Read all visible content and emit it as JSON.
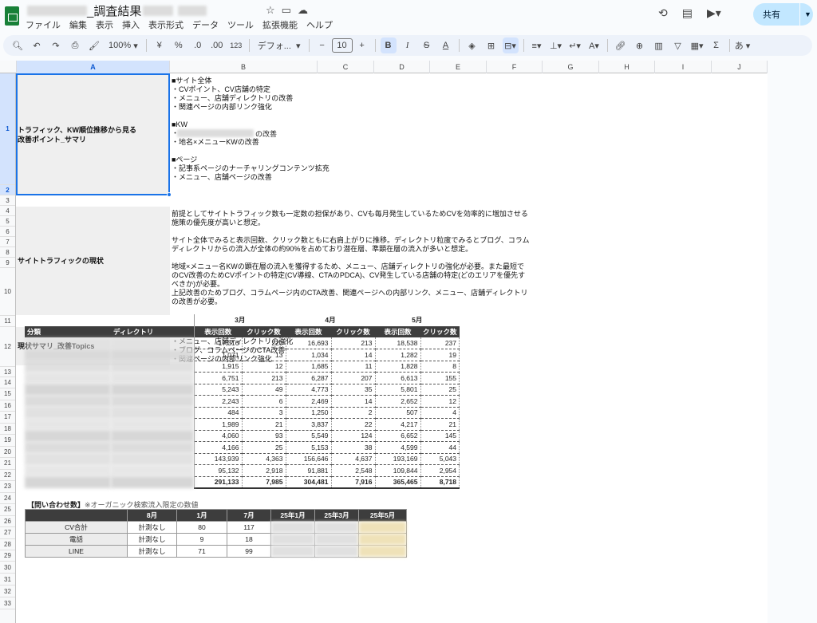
{
  "header": {
    "title": "_調査結果",
    "menu": [
      "ファイル",
      "編集",
      "表示",
      "挿入",
      "表示形式",
      "データ",
      "ツール",
      "拡張機能",
      "ヘルプ"
    ],
    "share_label": "共有"
  },
  "toolbar": {
    "zoom": "100%",
    "currency": "¥",
    "percent": "%",
    "dec_decrease": ".0",
    "dec_increase": ".00",
    "number_format": "123",
    "font": "デフォ...",
    "font_size": "10",
    "bold": "B",
    "italic": "I",
    "input_tool": "あ"
  },
  "columns": [
    "A",
    "B",
    "C",
    "D",
    "E",
    "F",
    "G",
    "H",
    "I",
    "J"
  ],
  "rows": [
    "1",
    "2",
    "3",
    "4",
    "5",
    "6",
    "7",
    "8",
    "9",
    "10",
    "11",
    "12",
    "13",
    "14",
    "15",
    "16",
    "17",
    "18",
    "19",
    "20",
    "21",
    "22",
    "23",
    "24",
    "25",
    "26",
    "27",
    "28",
    "29",
    "30",
    "31",
    "32",
    "33"
  ],
  "cells": {
    "a1": "トラフィック、KW順位推移から見る\n改善ポイント_サマリ",
    "b1": "■サイト全体\n・CVポイント、CV店舗の特定\n・メニュー、店舗ディレクトリの改善\n・関連ページの内部リンク強化\n\n■KW\n・\n・地名×メニューKWの改善\n\n■ページ\n・記事系ページのナーチャリングコンテンツ拡充\n・メニュー、店舗ページの改善",
    "b1_kw_suffix": "の改善",
    "a4": "サイトトラフィックの現状",
    "b4": "前提としてサイトトラフィック数も一定数の担保があり、CVも毎月発生しているためCVを効率的に増加させる\n施策の優先度が高いと想定。\n\nサイト全体でみると表示回数、クリック数ともに右肩上がりに推移。ディレクトリ粒度でみるとブログ、コラム\nディレクトリからの流入が全体の約90%を占めており潜在層、準顕在層の流入が多いと想定。\n\n地域×メニュー名KWの顕在層の流入を獲得するため、メニュー、店舗ディレクトリの強化が必要。また最短で\nのCV改善のためCVポイントの特定(CV導線、CTAのPDCA)、CV発生している店舗の特定(どのエリアを優先す\nべきか)が必要。\n上記改善のためブログ、コラムページ内のCTA改善、関連ページへの内部リンク、メニュー、店舗ディレクトリ\nの改善が必要。",
    "a12": "現状サマリ_改善Topics",
    "b12": "・CVポイント、CV店舗の特定\n・メニュー、店舗ディレクトリの強化\n・ブログ、コラムページのCTA改善\n・関連ページの内部リンク強化"
  },
  "kw_table": {
    "months": [
      "3月",
      "4月",
      "5月"
    ],
    "headers": [
      "分類",
      "ディレクトリ",
      "表示回数",
      "クリック数",
      "表示回数",
      "クリック数",
      "表示回数",
      "クリック数"
    ],
    "rows": [
      [
        "17,316",
        "220",
        "16,693",
        "213",
        "18,538",
        "237"
      ],
      [
        "1,071",
        "13",
        "1,034",
        "14",
        "1,282",
        "19"
      ],
      [
        "1,915",
        "12",
        "1,685",
        "11",
        "1,828",
        "8"
      ],
      [
        "6,751",
        "213",
        "6,287",
        "207",
        "6,613",
        "155"
      ],
      [
        "5,243",
        "49",
        "4,773",
        "35",
        "5,801",
        "25"
      ],
      [
        "2,243",
        "6",
        "2,469",
        "14",
        "2,652",
        "12"
      ],
      [
        "484",
        "3",
        "1,250",
        "2",
        "507",
        "4"
      ],
      [
        "1,989",
        "21",
        "3,837",
        "22",
        "4,217",
        "21"
      ],
      [
        "4,060",
        "93",
        "5,549",
        "124",
        "6,652",
        "145"
      ],
      [
        "4,166",
        "25",
        "5,153",
        "38",
        "4,599",
        "44"
      ],
      [
        "143,939",
        "4,363",
        "156,646",
        "4,637",
        "193,169",
        "5,043"
      ],
      [
        "95,132",
        "2,918",
        "91,881",
        "2,548",
        "109,844",
        "2,954"
      ]
    ],
    "total": [
      "291,133",
      "7,985",
      "304,481",
      "7,916",
      "365,465",
      "8,718"
    ]
  },
  "inquiry": {
    "title": "【問い合わせ数】",
    "note": "※オーガニック検索流入限定の数値",
    "headers": [
      "",
      "8月",
      "1月",
      "7月",
      "25年1月",
      "25年3月",
      "25年5月"
    ],
    "rows": [
      [
        "CV合計",
        "計測なし",
        "80",
        "117"
      ],
      [
        "電話",
        "計測なし",
        "9",
        "18"
      ],
      [
        "LINE",
        "計測なし",
        "71",
        "99"
      ]
    ]
  }
}
